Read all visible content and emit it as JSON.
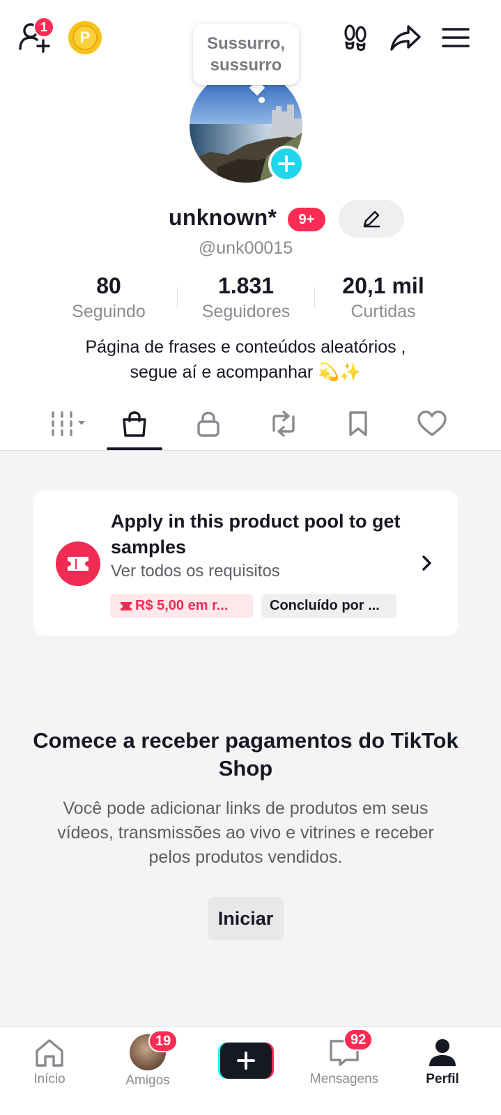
{
  "header": {
    "add_friend_count": "1",
    "coin_letter": "P"
  },
  "profile": {
    "bubble_text": "Sussurro, sussurro",
    "display_name": "unknown*",
    "name_badge": "9+",
    "username": "@unk00015"
  },
  "stats": [
    {
      "value": "80",
      "label": "Seguindo"
    },
    {
      "value": "1.831",
      "label": "Seguidores"
    },
    {
      "value": "20,1 mil",
      "label": "Curtidas"
    }
  ],
  "bio": {
    "line1": "Página de  frases e conteúdos aleatórios ,",
    "line2": "segue aí e acompanhar 💫✨"
  },
  "card": {
    "title": "Apply in this product pool to get samples",
    "subtitle": "Ver todos os requisitos",
    "tag_reward": "R$ 5,00 em r...",
    "tag_status": "Concluído por ..."
  },
  "promo": {
    "title": "Comece a receber pagamentos do TikTok Shop",
    "text": "Você pode adicionar links de produtos em seus vídeos, transmissões ao vivo e vitrines e receber pelos produtos vendidos.",
    "button": "Iniciar"
  },
  "nav": {
    "home": "Início",
    "friends": "Amigos",
    "friends_badge": "19",
    "messages": "Mensagens",
    "messages_badge": "92",
    "profile": "Perfil"
  },
  "colors": {
    "accent": "#fe2c55",
    "cyan": "#20d5ec",
    "coin": "#f6c31c"
  }
}
